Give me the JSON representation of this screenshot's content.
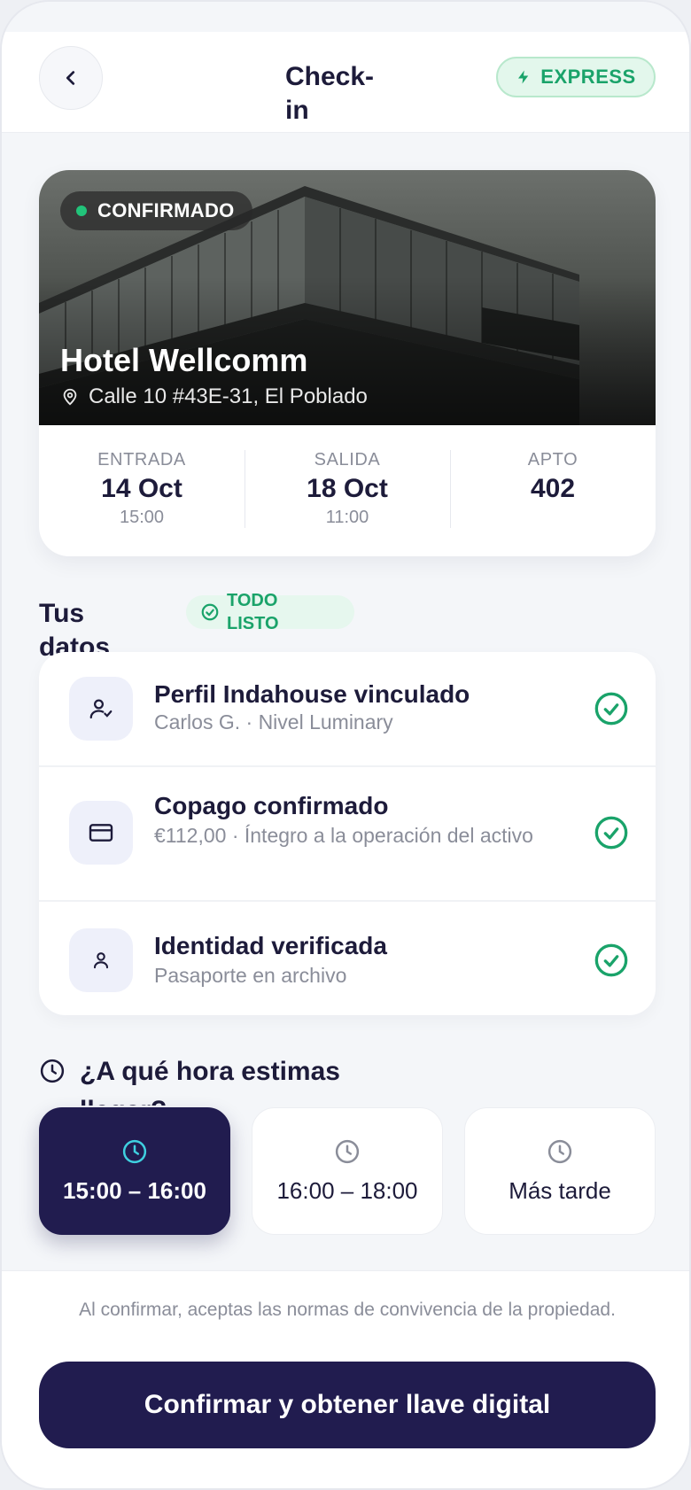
{
  "header": {
    "title": "Check-in",
    "badge": "EXPRESS"
  },
  "hotel": {
    "status": "CONFIRMADO",
    "name": "Hotel Wellcomm",
    "address": "Calle 10 #43E-31, El Poblado",
    "stays": [
      {
        "label": "ENTRADA",
        "value": "14 Oct",
        "time": "15:00"
      },
      {
        "label": "SALIDA",
        "value": "18 Oct",
        "time": "11:00"
      },
      {
        "label": "APTO",
        "value": "402",
        "time": ""
      }
    ]
  },
  "data_section": {
    "title": "Tus datos",
    "status": "TODO LISTO",
    "items": [
      {
        "icon": "user-check-icon",
        "title": "Perfil Indahouse vinculado",
        "subtitle": "Carlos G. · Nivel Luminary"
      },
      {
        "icon": "credit-card-icon",
        "title": "Copago confirmado",
        "subtitle": "€112,00 · Íntegro a la operación del activo"
      },
      {
        "icon": "user-icon",
        "title": "Identidad verificada",
        "subtitle": "Pasaporte en archivo"
      }
    ]
  },
  "arrival": {
    "title": "¿A qué hora estimas llegar?",
    "options": [
      {
        "label": "15:00 – 16:00",
        "selected": true
      },
      {
        "label": "16:00 – 18:00",
        "selected": false
      },
      {
        "label": "Más tarde",
        "selected": false
      }
    ]
  },
  "footer": {
    "terms": "Al confirmar, aceptas las normas de convivencia de la propiedad.",
    "cta": "Confirmar y obtener llave digital"
  },
  "colors": {
    "primary": "#211c4f",
    "success": "#1aa36a",
    "accent_cyan": "#3fd0e0"
  }
}
